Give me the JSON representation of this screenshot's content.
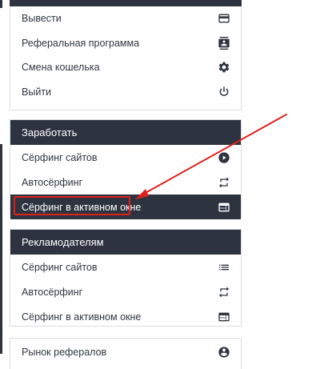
{
  "menu_top": {
    "items": [
      {
        "label": "Вывести",
        "icon": "credit-card-icon"
      },
      {
        "label": "Реферальная программа",
        "icon": "contact-book-icon"
      },
      {
        "label": "Смена кошелька",
        "icon": "gear-icon"
      },
      {
        "label": "Выйти",
        "icon": "power-icon"
      }
    ]
  },
  "earn": {
    "header": "Заработать",
    "items": [
      {
        "label": "Сёрфинг сайтов",
        "icon": "play-circle-icon"
      },
      {
        "label": "Автосёрфинг",
        "icon": "repeat-icon"
      },
      {
        "label": "Сёрфинг в активном окне",
        "icon": "web-window-icon",
        "active": true
      }
    ]
  },
  "advertisers": {
    "header": "Рекламодателям",
    "items": [
      {
        "label": "Сёрфинг сайтов",
        "icon": "list-icon"
      },
      {
        "label": "Автосёрфинг",
        "icon": "repeat-icon"
      },
      {
        "label": "Сёрфинг в активном окне",
        "icon": "web-window-icon"
      }
    ]
  },
  "menu_bottom": {
    "items": [
      {
        "label": "Рынок рефералов",
        "icon": "account-circle-icon"
      }
    ]
  },
  "colors": {
    "dark": "#2d3440",
    "annotation_red": "#e0201d",
    "border": "#d9dde2"
  }
}
